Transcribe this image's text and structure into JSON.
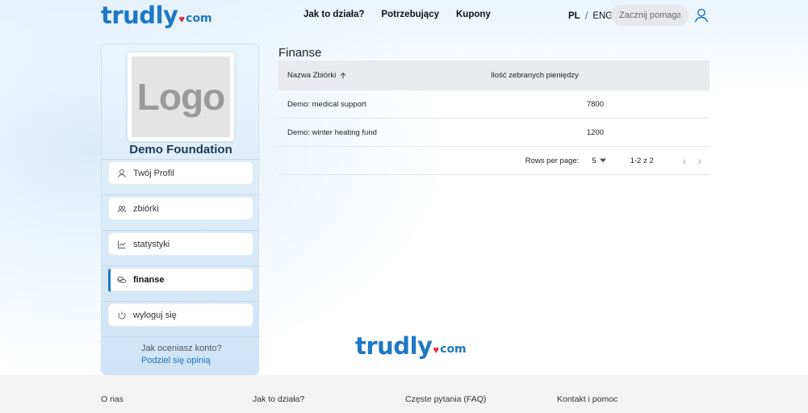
{
  "header": {
    "logo_main": "trudly",
    "logo_com": "com",
    "nav": [
      "Jak to działa?",
      "Potrzebujący",
      "Kupony"
    ],
    "lang_pl": "PL",
    "lang_sep": "/",
    "lang_eng": "ENG",
    "search_placeholder": "Zacznij pomagać"
  },
  "sidebar": {
    "logo_text": "Logo",
    "org_name": "Demo Foundation",
    "items": [
      {
        "label": "Twój Profil",
        "icon": "user-icon"
      },
      {
        "label": "zbiórki",
        "icon": "users-icon"
      },
      {
        "label": "statystyki",
        "icon": "chart-icon"
      },
      {
        "label": "finanse",
        "icon": "coins-icon",
        "active": true
      },
      {
        "label": "wyloguj się",
        "icon": "power-icon"
      }
    ],
    "rate_question": "Jak oceniasz konto?",
    "rate_link": "Podziel się opinią"
  },
  "main": {
    "title": "Finanse",
    "table": {
      "col_name": "Nazwa Zbiórki",
      "col_amount": "Ilość zebranych pieniędzy",
      "rows": [
        {
          "name": "Demo: medical support",
          "amount": "7800"
        },
        {
          "name": "Demo: winter heating fund",
          "amount": "1200"
        }
      ],
      "rows_per_page_label": "Rows per page:",
      "rows_per_page": "5",
      "range": "1-2 z 2"
    }
  },
  "footer": {
    "links": [
      "O nas",
      "Jak to działa?",
      "Częste pytania (FAQ)",
      "Kontakt i pomoc"
    ]
  },
  "colors": {
    "brand": "#1e78c4",
    "heart": "#e02a3a"
  }
}
